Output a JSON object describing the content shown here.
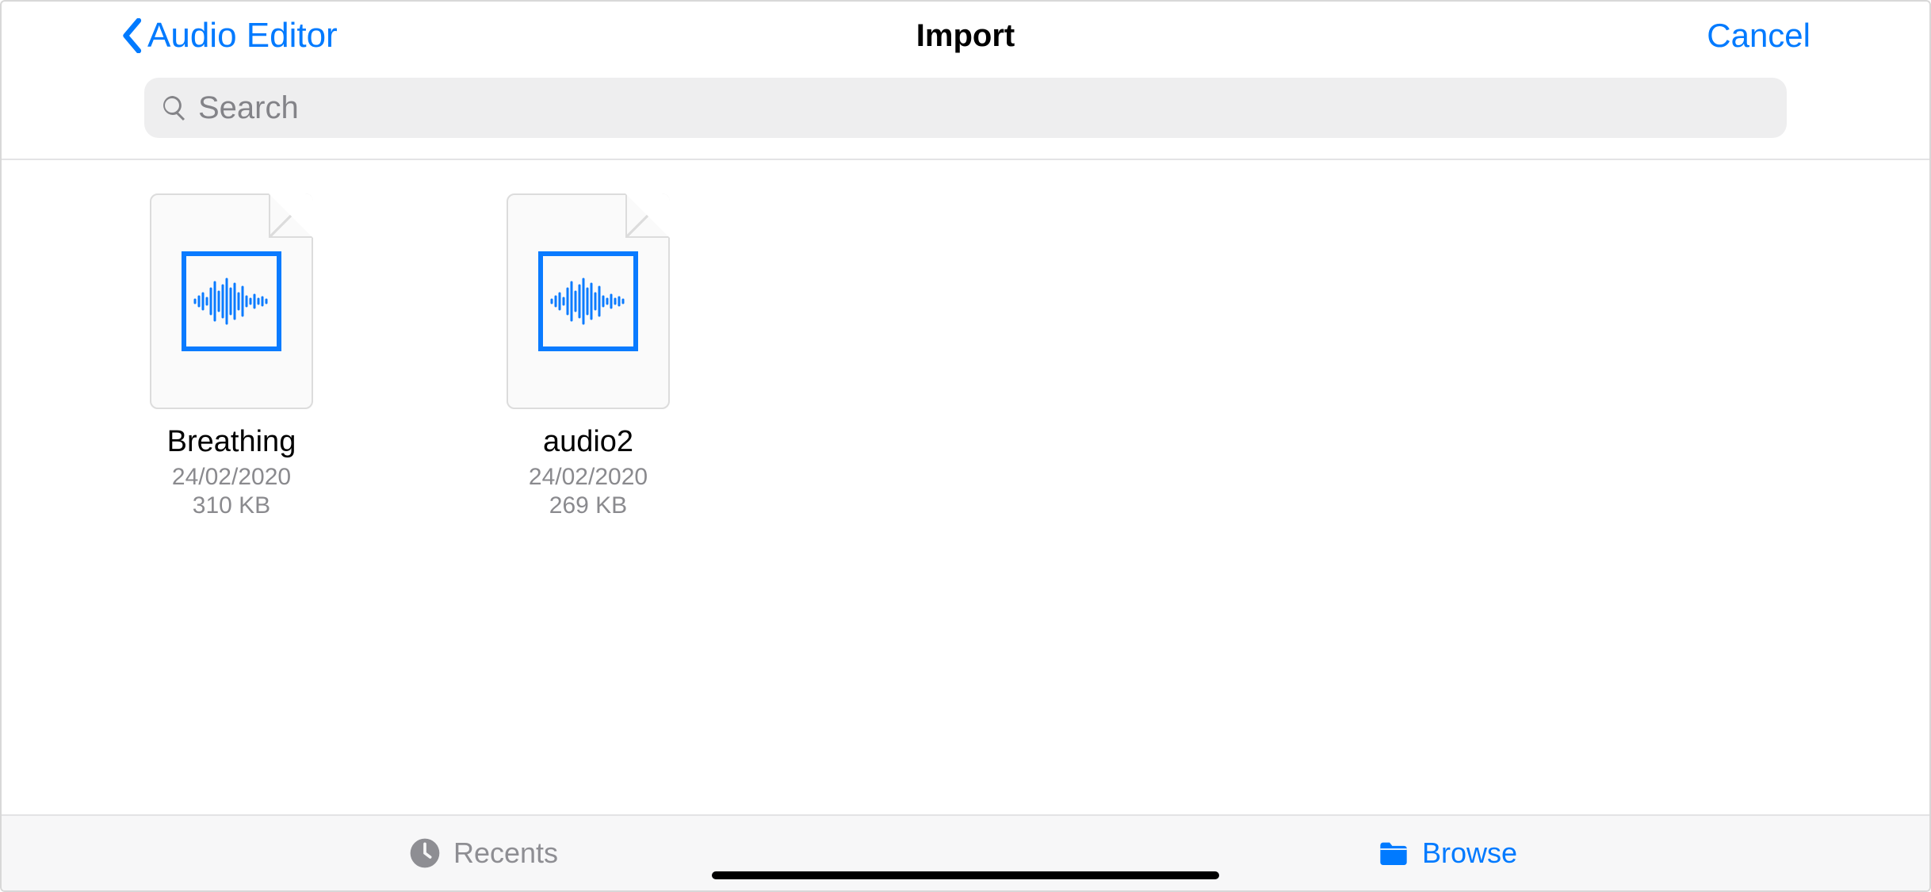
{
  "nav": {
    "back_label": "Audio Editor",
    "title": "Import",
    "cancel_label": "Cancel"
  },
  "search": {
    "placeholder": "Search"
  },
  "files": [
    {
      "name": "Breathing",
      "date": "24/02/2020",
      "size": "310 KB"
    },
    {
      "name": "audio2",
      "date": "24/02/2020",
      "size": "269 KB"
    }
  ],
  "tabs": {
    "recents_label": "Recents",
    "browse_label": "Browse"
  }
}
